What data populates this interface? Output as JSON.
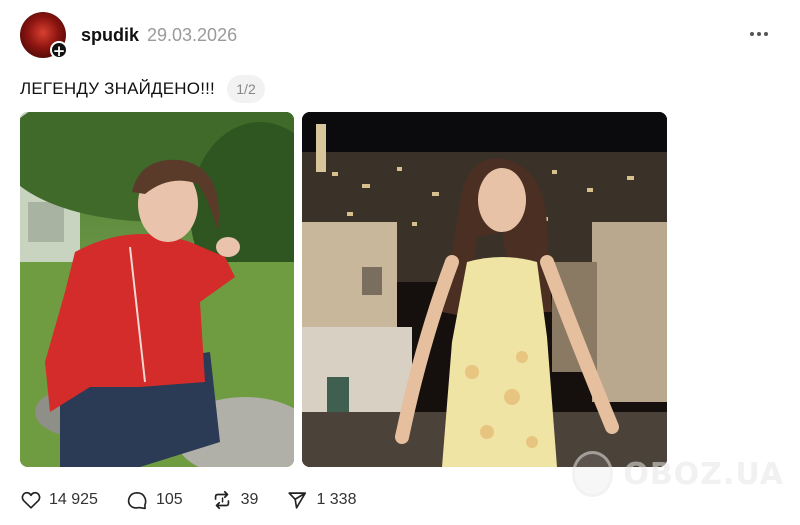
{
  "post": {
    "author": {
      "username": "spudik",
      "follow_symbol": "+"
    },
    "date": "29.03.2026",
    "text": "ЛЕГЕНДУ ЗНАЙДЕНО!!!",
    "media_counter": "1/2"
  },
  "stats": {
    "likes": "14 925",
    "comments": "105",
    "reposts": "39",
    "shares": "1 338"
  },
  "watermark": {
    "text": "OBOZ.UA"
  },
  "icons": {
    "more": "more-horizontal-icon",
    "like": "heart-icon",
    "comment": "comment-bubble-icon",
    "repost": "repost-icon",
    "share": "send-icon"
  }
}
